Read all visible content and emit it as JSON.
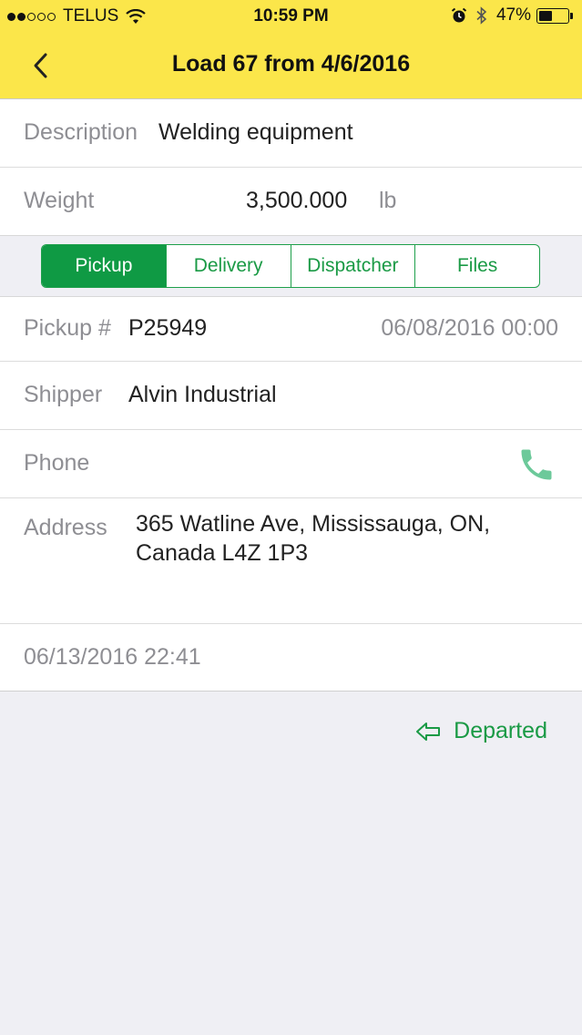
{
  "status_bar": {
    "carrier": "TELUS",
    "time": "10:59 PM",
    "battery_percent": "47%",
    "battery_level": 0.47,
    "signal_bars_filled": 2,
    "signal_bars_total": 5
  },
  "nav": {
    "title": "Load 67 from 4/6/2016"
  },
  "load": {
    "description_label": "Description",
    "description_value": "Welding equipment",
    "weight_label": "Weight",
    "weight_value": "3,500.000",
    "weight_unit": "lb"
  },
  "tabs": [
    {
      "label": "Pickup",
      "active": true
    },
    {
      "label": "Delivery",
      "active": false
    },
    {
      "label": "Dispatcher",
      "active": false
    },
    {
      "label": "Files",
      "active": false
    }
  ],
  "pickup": {
    "number_label": "Pickup #",
    "number_value": "P25949",
    "datetime": "06/08/2016 00:00",
    "shipper_label": "Shipper",
    "shipper_value": "Alvin Industrial",
    "phone_label": "Phone",
    "address_label": "Address",
    "address_line1": "365 Watline Ave, Mississauga, ON,",
    "address_line2": "Canada L4Z 1P3",
    "event_datetime": "06/13/2016 22:41"
  },
  "actions": {
    "departed_label": "Departed"
  },
  "colors": {
    "header": "#fbe64a",
    "accent_green": "#1a9a45",
    "phone_green": "#6cc99a",
    "label_gray": "#8e8e93"
  },
  "icons": [
    "back-chevron-icon",
    "wifi-icon",
    "alarm-icon",
    "bluetooth-icon",
    "battery-icon",
    "phone-icon",
    "departed-arrow-icon"
  ]
}
